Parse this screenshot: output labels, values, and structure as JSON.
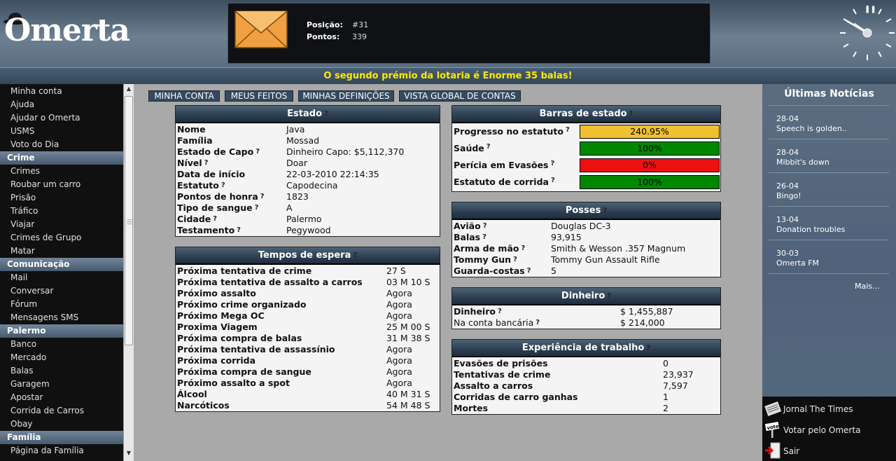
{
  "header": {
    "logo_text": "Omerta",
    "position_label": "Posição:",
    "position_value": "#31",
    "points_label": "Pontos:",
    "points_value": "339"
  },
  "announcement": "O segundo prémio da lotaria é Enorme 35 balas!",
  "sidebar": {
    "groups": [
      {
        "title": "",
        "items": [
          "Minha conta",
          "Ajuda",
          "Ajudar o Omerta",
          "USMS",
          "Voto do Dia"
        ]
      },
      {
        "title": "Crime",
        "items": [
          "Crimes",
          "Roubar um carro",
          "Prisão",
          "Tráfico",
          "Viajar",
          "Crimes de Grupo",
          "Matar"
        ]
      },
      {
        "title": "Comunicação",
        "items": [
          "Mail",
          "Conversar",
          "Fórum",
          "Mensagens SMS"
        ]
      },
      {
        "title": "Palermo",
        "items": [
          "Banco",
          "Mercado",
          "Balas",
          "Garagem",
          "Apostar",
          "Corrida de Carros",
          "Obay"
        ]
      },
      {
        "title": "Família",
        "items": [
          "Página da Família"
        ]
      }
    ]
  },
  "tabs": [
    "MINHA CONTA",
    "MEUS FEITOS",
    "MINHAS DEFINIÇÕES",
    "VISTA GLOBAL DE CONTAS"
  ],
  "estado": {
    "title": "Estado",
    "rows": [
      {
        "label": "Nome",
        "value": "Java",
        "help": false
      },
      {
        "label": "Família",
        "value": "Mossad",
        "help": false
      },
      {
        "label": "Estado de Capo",
        "value": "Dinheiro Capo: $5,112,370",
        "help": true
      },
      {
        "label": "Nível",
        "value": "Doar",
        "help": true
      },
      {
        "label": "Data de início",
        "value": "22-03-2010 22:14:35",
        "help": false
      },
      {
        "label": "Estatuto",
        "value": "Capodecina",
        "help": true
      },
      {
        "label": "Pontos de honra",
        "value": "1823",
        "help": true
      },
      {
        "label": "Tipo de sangue",
        "value": "A",
        "help": true
      },
      {
        "label": "Cidade",
        "value": "Palermo",
        "help": true
      },
      {
        "label": "Testamento",
        "value": "Pegywood",
        "help": true
      }
    ]
  },
  "tempos": {
    "title": "Tempos de espera",
    "rows": [
      {
        "label": "Próxima tentativa de crime",
        "value": "27 S"
      },
      {
        "label": "Próxima tentativa de assalto a carros",
        "value": "03 M 10 S"
      },
      {
        "label": "Próximo assalto",
        "value": "Agora"
      },
      {
        "label": "Próximo crime organizado",
        "value": "Agora"
      },
      {
        "label": "Próximo Mega OC",
        "value": "Agora"
      },
      {
        "label": "Proxima Viagem",
        "value": "25 M 00 S"
      },
      {
        "label": "Próxima compra de balas",
        "value": "31 M 38 S"
      },
      {
        "label": "Próxima tentativa de assassínio",
        "value": "Agora"
      },
      {
        "label": "Próxima corrida",
        "value": "Agora"
      },
      {
        "label": "Próxima compra de sangue",
        "value": "Agora"
      },
      {
        "label": "Próximo assalto a spot",
        "value": "Agora"
      },
      {
        "label": "Álcool",
        "value": "40 M 31 S"
      },
      {
        "label": "Narcóticos",
        "value": "54 M 48 S"
      }
    ]
  },
  "barras": {
    "title": "Barras de estado",
    "rows": [
      {
        "label": "Progresso no estatuto",
        "value": "240.95%",
        "color": "#f0c030"
      },
      {
        "label": "Saúde",
        "value": "100%",
        "color": "#008800"
      },
      {
        "label": "Perícia em Evasões",
        "value": "0%",
        "color": "#ee1111"
      },
      {
        "label": "Estatuto de corrida",
        "value": "100%",
        "color": "#008800"
      }
    ]
  },
  "posses": {
    "title": "Posses",
    "rows": [
      {
        "label": "Avião",
        "value": "Douglas DC-3"
      },
      {
        "label": "Balas",
        "value": "93,915"
      },
      {
        "label": "Arma de mão",
        "value": "Smith & Wesson .357 Magnum"
      },
      {
        "label": "Tommy Gun",
        "value": "Tommy Gun Assault Rifle"
      },
      {
        "label": "Guarda-costas",
        "value": "5"
      }
    ]
  },
  "dinheiro": {
    "title": "Dinheiro",
    "rows": [
      {
        "label": "Dinheiro",
        "value": "$ 1,455,887",
        "bold": true
      },
      {
        "label": "Na conta bancária",
        "value": "$ 214,000",
        "bold": false
      }
    ]
  },
  "experiencia": {
    "title": "Experiência de trabalho",
    "rows": [
      {
        "label": "Evasões de prisões",
        "value": "0"
      },
      {
        "label": "Tentativas de crime",
        "value": "23,937"
      },
      {
        "label": "Assalto a carros",
        "value": "7,597"
      },
      {
        "label": "Corridas de carro ganhas",
        "value": "1"
      },
      {
        "label": "Mortes",
        "value": "2"
      }
    ]
  },
  "news": {
    "title": "Últimas Notícias",
    "items": [
      {
        "date": "28-04",
        "text": "Speech is golden.."
      },
      {
        "date": "28-04",
        "text": "Mibbit's down"
      },
      {
        "date": "26-04",
        "text": "Bingo!"
      },
      {
        "date": "13-04",
        "text": "Donation troubles"
      },
      {
        "date": "30-03",
        "text": "Omerta FM"
      }
    ],
    "more": "Mais...",
    "bottom_links": [
      {
        "label": "Jornal The Times",
        "icon": "newspaper-icon"
      },
      {
        "label": "Votar pelo Omerta",
        "icon": "vote-sign-icon"
      },
      {
        "label": "Sair",
        "icon": "exit-door-icon"
      }
    ]
  }
}
